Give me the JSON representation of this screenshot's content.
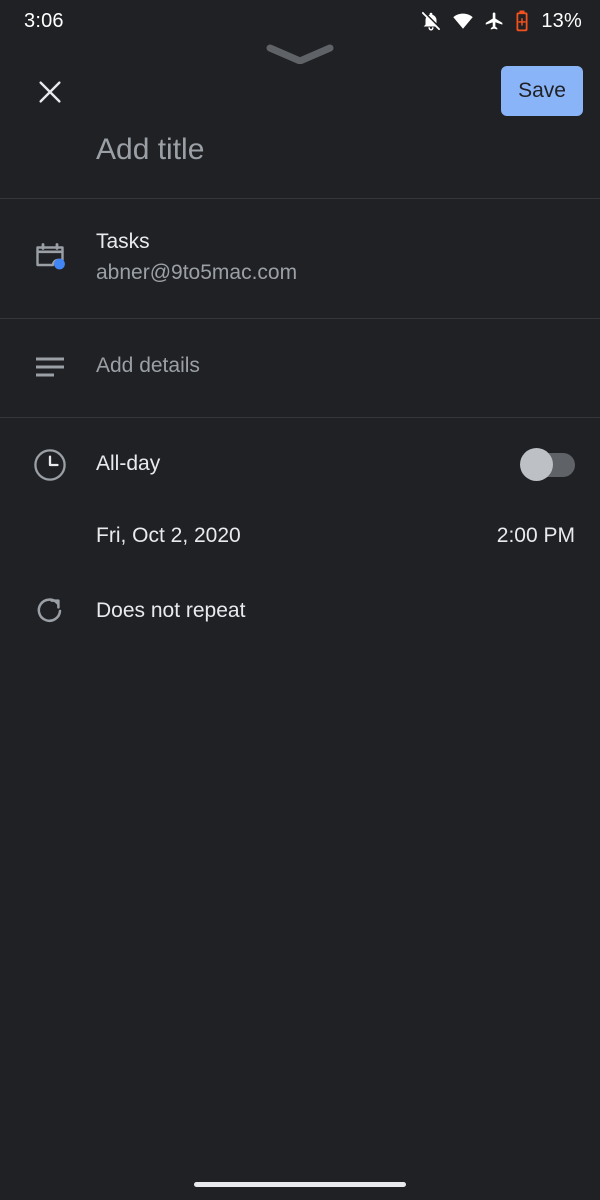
{
  "status_bar": {
    "time": "3:06",
    "battery_percent": "13%",
    "icons": [
      {
        "name": "notifications-off-icon",
        "label": "Notifications silenced"
      },
      {
        "name": "wifi-icon",
        "label": "Wi-Fi connected"
      },
      {
        "name": "airplane-mode-icon",
        "label": "Airplane mode on"
      },
      {
        "name": "battery-charging-icon",
        "label": "Battery charging"
      }
    ]
  },
  "app_bar": {
    "close_label": "Close",
    "save_label": "Save",
    "save_bg": "#8ab4f8",
    "save_fg": "#202124"
  },
  "drag_handle": {
    "name": "chevron-down-handle",
    "color": "#5f6368"
  },
  "title_field": {
    "value": "",
    "placeholder": "Add title"
  },
  "calendar_row": {
    "icon": "calendar-icon",
    "dot_color": "#4285f4",
    "title": "Tasks",
    "account": "abner@9to5mac.com"
  },
  "details_row": {
    "icon": "description-icon",
    "value": "",
    "placeholder": "Add details"
  },
  "allday_row": {
    "icon": "clock-icon",
    "label": "All-day",
    "toggle_state": "off",
    "toggle_track_color": "#5f6368",
    "toggle_thumb_color": "#bdc1c6"
  },
  "datetime_row": {
    "date": "Fri, Oct 2, 2020",
    "time": "2:00 PM"
  },
  "repeat_row": {
    "icon": "repeat-icon",
    "label": "Does not repeat"
  },
  "nav_bar": {
    "pill_color": "#e8eaed"
  },
  "theme": {
    "background": "#202124",
    "primary_text": "#e8eaed",
    "secondary_text": "#9aa0a6",
    "divider": "#35373a"
  }
}
